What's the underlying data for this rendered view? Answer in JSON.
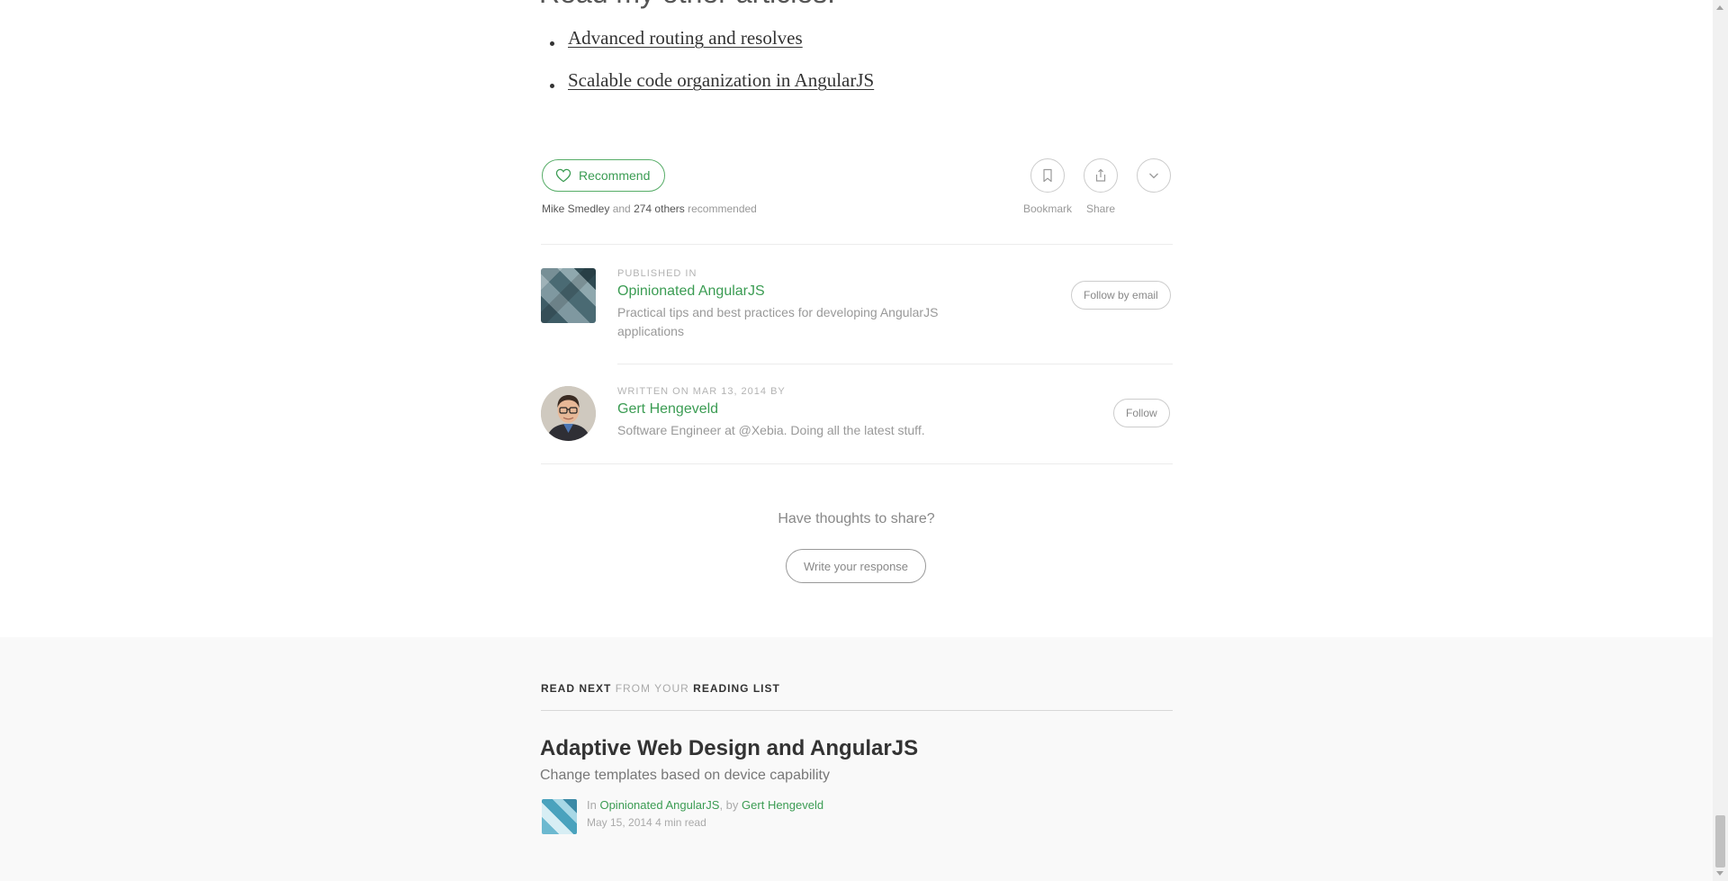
{
  "article_end": {
    "heading": "Read my other articles:",
    "links": [
      {
        "label": "Advanced routing and resolves"
      },
      {
        "label": "Scalable code organization in AngularJS"
      }
    ]
  },
  "actions": {
    "recommend_label": "Recommend",
    "recommenders_name": "Mike Smedley",
    "recommenders_and": "and",
    "recommenders_others": "274 others",
    "recommenders_suffix": "recommended",
    "bookmark_label": "Bookmark",
    "share_label": "Share",
    "accent_color": "#3b9c53"
  },
  "publication": {
    "eyebrow": "PUBLISHED IN",
    "name": "Opinionated AngularJS",
    "description": "Practical tips and best practices for developing AngularJS applications",
    "follow_label": "Follow by email"
  },
  "author": {
    "eyebrow": "WRITTEN ON MAR 13, 2014 BY",
    "name": "Gert Hengeveld",
    "bio": "Software Engineer at @Xebia. Doing all the latest stuff.",
    "follow_label": "Follow"
  },
  "responses": {
    "prompt": "Have thoughts to share?",
    "write_label": "Write your response"
  },
  "read_next": {
    "label_part1": "READ NEXT",
    "label_part2": "FROM YOUR",
    "label_part3": "READING LIST",
    "title": "Adaptive Web Design and AngularJS",
    "subtitle": "Change templates based on device capability",
    "in_prefix": "In",
    "publication": "Opinionated AngularJS",
    "by_prefix": ", by",
    "author": "Gert Hengeveld",
    "date": "May 15, 2014",
    "read_time": "4 min read"
  }
}
